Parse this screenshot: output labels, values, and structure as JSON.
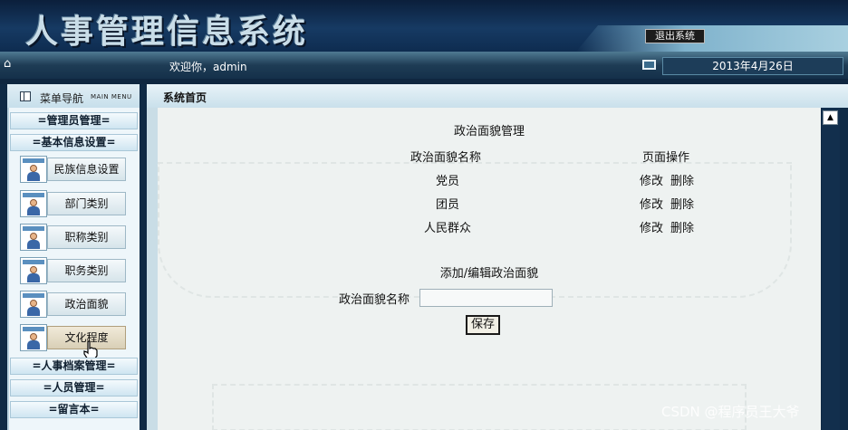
{
  "header": {
    "title": "人事管理信息系统",
    "logout_label": "退出系统"
  },
  "navbar": {
    "welcome": "欢迎你，admin",
    "date": "2013年4月26日"
  },
  "sidebar": {
    "title": "菜单导航",
    "subtitle": "MAIN MENU",
    "categories": [
      {
        "label": "=管理员管理="
      },
      {
        "label": "=基本信息设置="
      },
      {
        "label": "=人事档案管理="
      },
      {
        "label": "=人员管理="
      },
      {
        "label": "=留言本="
      }
    ],
    "items": [
      {
        "label": "民族信息设置"
      },
      {
        "label": "部门类别"
      },
      {
        "label": "职称类别"
      },
      {
        "label": "职务类别"
      },
      {
        "label": "政治面貌"
      },
      {
        "label": "文化程度"
      }
    ]
  },
  "breadcrumb": {
    "label": "系统首页"
  },
  "main": {
    "table_title": "政治面貌管理",
    "col_name": "政治面貌名称",
    "col_action": "页面操作",
    "rows": [
      {
        "name": "党员",
        "edit": "修改",
        "delete": "删除"
      },
      {
        "name": "团员",
        "edit": "修改",
        "delete": "删除"
      },
      {
        "name": "人民群众",
        "edit": "修改",
        "delete": "删除"
      }
    ],
    "form_title": "添加/编辑政治面貌",
    "field_label": "政治面貌名称",
    "field_value": "",
    "save_label": "保存"
  },
  "watermark": "CSDN @程序员王大爷",
  "colors": {
    "header_bg": "#163a63",
    "navbar_bg": "#1e3c55",
    "panel_bg": "#eef2f1"
  }
}
